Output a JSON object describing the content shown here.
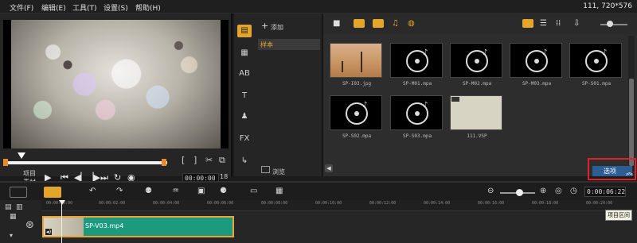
{
  "menu": {
    "items": [
      "文件(F)",
      "编辑(E)",
      "工具(T)",
      "设置(S)",
      "帮助(H)"
    ],
    "status": "111, 720*576"
  },
  "preview": {
    "mode_project": "项目",
    "mode_clip": "素材",
    "timecode": "00:00:00",
    "timecode_suffix": "18"
  },
  "library": {
    "add_label": "添加",
    "folder_label": "样本",
    "browse_label": "浏览",
    "options_label": "选项",
    "thumbnails": [
      {
        "caption": "SP-I03.jpg",
        "kind": "image"
      },
      {
        "caption": "SP-M01.mpa",
        "kind": "audio"
      },
      {
        "caption": "SP-M02.mpa",
        "kind": "audio"
      },
      {
        "caption": "SP-M03.mpa",
        "kind": "audio"
      },
      {
        "caption": "SP-S01.mpa",
        "kind": "audio"
      },
      {
        "caption": "SP-S02.mpa",
        "kind": "audio"
      },
      {
        "caption": "SP-S03.mpa",
        "kind": "audio"
      },
      {
        "caption": "111.VSP",
        "kind": "project"
      }
    ]
  },
  "timeline": {
    "timecode": "0:00:06:22",
    "tooltip": "项目区间",
    "ruler": [
      "00:00:00:00",
      "00:00:02:00",
      "00:00:04:00",
      "00:00:06:00",
      "00:00:08:00",
      "00:00:10:00",
      "00:00:12:00",
      "00:00:14:00",
      "00:00:16:00",
      "00:00:18:00",
      "00:00:20:00"
    ],
    "clip_label": "SP-V03.mp4"
  },
  "colors": {
    "accent": "#e3a62a",
    "clip": "#1d9a7d",
    "options_button": "#2c5e92",
    "highlight": "#e0202a"
  }
}
